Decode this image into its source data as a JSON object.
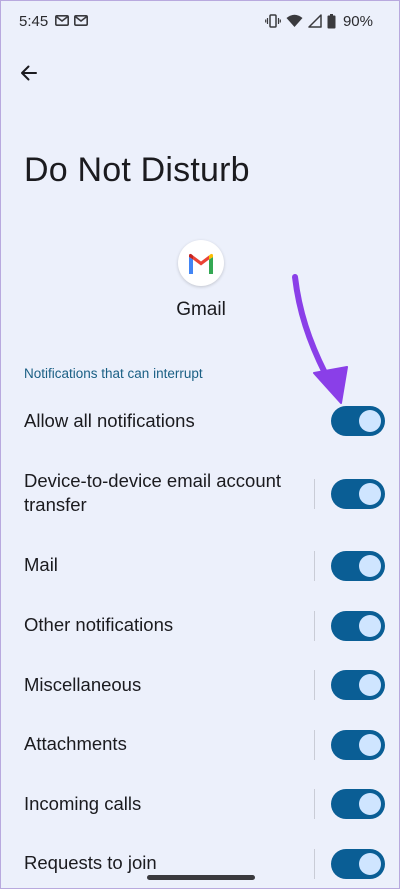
{
  "status_bar": {
    "time": "5:45",
    "battery_percent": "90%",
    "notification_icons": [
      "gmail-notification-icon",
      "gmail-notification-icon"
    ],
    "system_icons": [
      "vibrate-icon",
      "wifi-icon",
      "signal-icon",
      "battery-icon"
    ]
  },
  "header": {
    "back_icon": "arrow-back-icon",
    "title": "Do Not Disturb"
  },
  "app": {
    "icon": "gmail-logo",
    "name": "Gmail"
  },
  "section": {
    "header": "Notifications that can interrupt"
  },
  "settings": [
    {
      "label": "Allow all notifications",
      "enabled": true
    },
    {
      "label": "Device-to-device email account transfer",
      "enabled": true
    },
    {
      "label": "Mail",
      "enabled": true
    },
    {
      "label": "Other notifications",
      "enabled": true
    },
    {
      "label": "Miscellaneous",
      "enabled": true
    },
    {
      "label": "Attachments",
      "enabled": true
    },
    {
      "label": "Incoming calls",
      "enabled": true
    },
    {
      "label": "Requests to join",
      "enabled": true
    }
  ],
  "colors": {
    "background": "#ecf0fb",
    "toggle_on": "#0a5e95",
    "toggle_knob": "#cfe5ff",
    "section_header": "#1a5f84",
    "annotation_arrow": "#8a3fe8"
  }
}
